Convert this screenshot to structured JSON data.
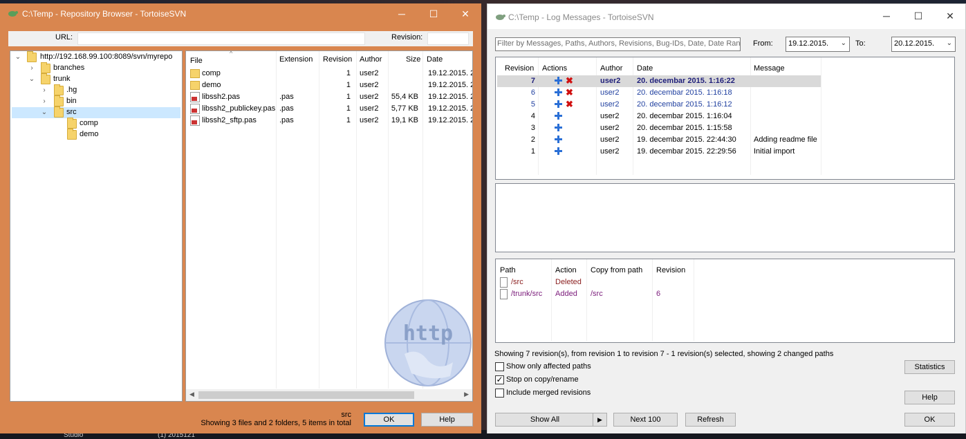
{
  "desktop": {
    "tb_text1": "Studio",
    "tb_text2": "(1) 2015121"
  },
  "repo_browser": {
    "title": "C:\\Temp - Repository Browser - TortoiseSVN",
    "minimize": "─",
    "maximize": "☐",
    "close": "✕",
    "url_label": "URL:",
    "revision_label": "Revision:",
    "tree": [
      {
        "label": "http://192.168.99.100:8089/svn/myrepo",
        "exp": "⌄"
      },
      {
        "label": "branches",
        "exp": "›"
      },
      {
        "label": "trunk",
        "exp": "⌄"
      },
      {
        "label": ".hg",
        "exp": "›"
      },
      {
        "label": "bin",
        "exp": "›"
      },
      {
        "label": "src",
        "exp": "⌄"
      },
      {
        "label": "comp",
        "exp": ""
      },
      {
        "label": "demo",
        "exp": ""
      }
    ],
    "columns": {
      "file": "File",
      "extension": "Extension",
      "revision": "Revision",
      "author": "Author",
      "size": "Size",
      "date": "Date"
    },
    "files": [
      {
        "name": "comp",
        "ext": "",
        "rev": "1",
        "author": "user2",
        "size": "",
        "date": "19.12.2015. 2",
        "kind": "folder"
      },
      {
        "name": "demo",
        "ext": "",
        "rev": "1",
        "author": "user2",
        "size": "",
        "date": "19.12.2015. 2",
        "kind": "folder"
      },
      {
        "name": "libssh2.pas",
        "ext": ".pas",
        "rev": "1",
        "author": "user2",
        "size": "55,4 KB",
        "date": "19.12.2015. 2",
        "kind": "pas"
      },
      {
        "name": "libssh2_publickey.pas",
        "ext": ".pas",
        "rev": "1",
        "author": "user2",
        "size": "5,77 KB",
        "date": "19.12.2015. 2",
        "kind": "pas"
      },
      {
        "name": "libssh2_sftp.pas",
        "ext": ".pas",
        "rev": "1",
        "author": "user2",
        "size": "19,1 KB",
        "date": "19.12.2015. 2",
        "kind": "pas"
      }
    ],
    "status_path": "src",
    "status_summary": "Showing 3 files and 2 folders, 5 items in total",
    "ok_label": "OK",
    "help_label": "Help",
    "watermark": "http"
  },
  "log": {
    "title": "C:\\Temp - Log Messages - TortoiseSVN",
    "minimize": "─",
    "maximize": "☐",
    "close": "✕",
    "filter_placeholder": "Filter by Messages, Paths, Authors, Revisions, Bug-IDs, Date, Date Rang",
    "from_label": "From:",
    "from_value": "19.12.2015.",
    "to_label": "To:",
    "to_value": "20.12.2015.",
    "columns": {
      "revision": "Revision",
      "actions": "Actions",
      "author": "Author",
      "date": "Date",
      "message": "Message"
    },
    "revisions": [
      {
        "rev": "7",
        "author": "user2",
        "date": "20. decembar 2015. 1:16:22",
        "msg": "",
        "deleted": true,
        "selected": true
      },
      {
        "rev": "6",
        "author": "user2",
        "date": "20. decembar 2015. 1:16:18",
        "msg": "",
        "deleted": true,
        "selected": false
      },
      {
        "rev": "5",
        "author": "user2",
        "date": "20. decembar 2015. 1:16:12",
        "msg": "",
        "deleted": true,
        "selected": false
      },
      {
        "rev": "4",
        "author": "user2",
        "date": "20. decembar 2015. 1:16:04",
        "msg": "",
        "deleted": false,
        "selected": false
      },
      {
        "rev": "3",
        "author": "user2",
        "date": "20. decembar 2015. 1:15:58",
        "msg": "",
        "deleted": false,
        "selected": false
      },
      {
        "rev": "2",
        "author": "user2",
        "date": "19. decembar 2015. 22:44:30",
        "msg": "Adding readme file",
        "deleted": false,
        "selected": false
      },
      {
        "rev": "1",
        "author": "user2",
        "date": "19. decembar 2015. 22:29:56",
        "msg": "Initial import",
        "deleted": false,
        "selected": false
      }
    ],
    "path_columns": {
      "path": "Path",
      "action": "Action",
      "copy_from": "Copy from path",
      "revision": "Revision"
    },
    "paths": [
      {
        "path": "/src",
        "action": "Deleted",
        "copy_from": "",
        "revision": ""
      },
      {
        "path": "/trunk/src",
        "action": "Added",
        "copy_from": "/src",
        "revision": "6"
      }
    ],
    "summary": "Showing 7 revision(s), from revision 1 to revision 7 - 1 revision(s) selected, showing 2 changed paths",
    "check_affected": "Show only affected paths",
    "check_stop": "Stop on copy/rename",
    "check_merged": "Include merged revisions",
    "check_mark": "✓",
    "statistics_label": "Statistics",
    "help_label": "Help",
    "show_all_label": "Show All",
    "next_label": "Next 100",
    "refresh_label": "Refresh",
    "ok_label": "OK"
  }
}
